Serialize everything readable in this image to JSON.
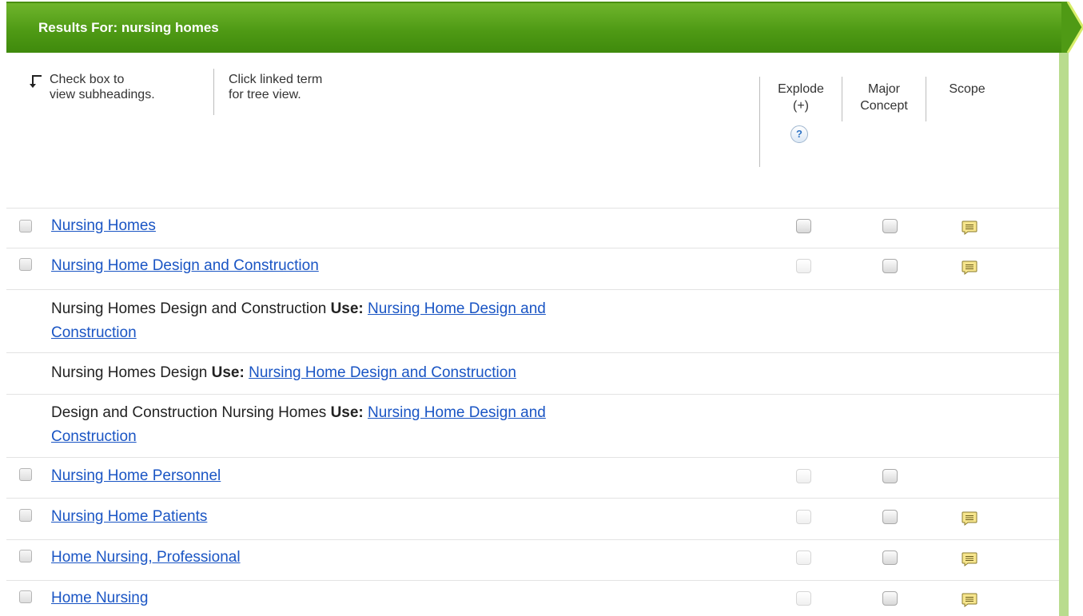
{
  "header": {
    "title": "Results For: nursing homes"
  },
  "instructions": {
    "checkbox_line1": "Check box to",
    "checkbox_line2": "view subheadings.",
    "tree_line1": "Click linked term",
    "tree_line2": "for tree view."
  },
  "columns": {
    "explode_line1": "Explode",
    "explode_line2": "(+)",
    "help": "?",
    "major_line1": "Major",
    "major_line2": "Concept",
    "scope": "Scope"
  },
  "use_label": "Use:",
  "rows": [
    {
      "term": "Nursing Homes",
      "explode_enabled": true,
      "scope": true
    },
    {
      "term": "Nursing Home Design and Construction",
      "explode_enabled": false,
      "scope": true
    },
    {
      "term": "Nursing Home Personnel",
      "explode_enabled": false,
      "scope": false
    },
    {
      "term": "Nursing Home Patients",
      "explode_enabled": false,
      "scope": true
    },
    {
      "term": "Home Nursing, Professional",
      "explode_enabled": false,
      "scope": true
    },
    {
      "term": "Home Nursing",
      "explode_enabled": false,
      "scope": true
    }
  ],
  "see_rows": [
    {
      "text": "Nursing Homes Design and Construction",
      "target": "Nursing Home Design and",
      "target_cont": "Construction"
    },
    {
      "text": "Nursing Homes Design",
      "target": "Nursing Home Design and Construction"
    },
    {
      "text": "Design and Construction Nursing Homes",
      "target": "Nursing Home Design and",
      "target_cont": "Construction"
    }
  ],
  "colors": {
    "header_green": "#4f9a15",
    "link_blue": "#1a55c4",
    "side_green": "#b9dc8e",
    "scope_yellow": "#f6e58d"
  },
  "icons": [
    "return-arrow-icon",
    "help-icon",
    "scope-note-icon",
    "chevron-right-icon"
  ]
}
